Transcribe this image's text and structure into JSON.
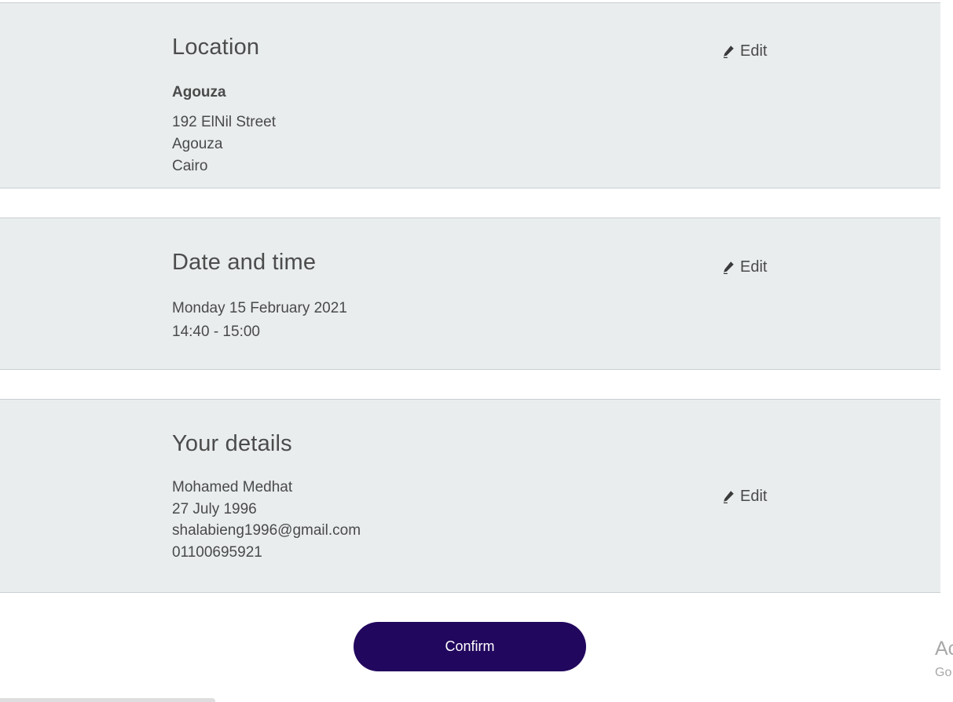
{
  "sections": {
    "location": {
      "title": "Location",
      "edit_label": "Edit",
      "name": "Agouza",
      "lines": [
        "192 ElNil Street",
        "Agouza",
        "Cairo"
      ]
    },
    "date_time": {
      "title": "Date and time",
      "edit_label": "Edit",
      "date": "Monday 15 February 2021",
      "time": "14:40 - 15:00"
    },
    "details": {
      "title": "Your details",
      "edit_label": "Edit",
      "name": "Mohamed Medhat",
      "birthdate": "27 July 1996",
      "email": "shalabieng1996@gmail.com",
      "phone": "01100695921"
    }
  },
  "confirm_label": "Confirm",
  "overlay": {
    "line1": "Ac",
    "line2": "Go"
  },
  "colors": {
    "panel_bg": "#e9edee",
    "button_bg": "#22075e",
    "text": "#4a4a4a"
  },
  "icons": {
    "edit": "pencil-icon"
  }
}
